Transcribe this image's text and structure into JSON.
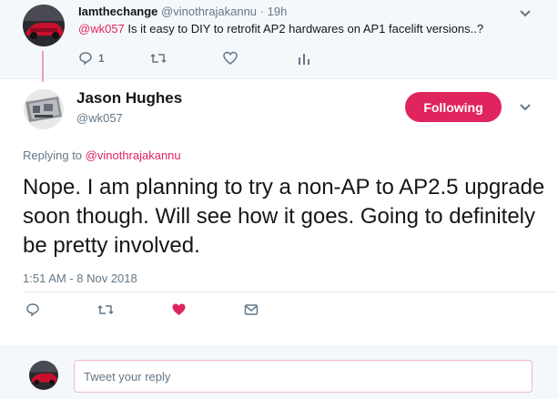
{
  "parent_tweet": {
    "display_name": "Iamthechange",
    "handle": "@vinothrajakannu",
    "separator": "·",
    "time": "19h",
    "mention": "@wk057",
    "text": " Is it easy to DIY to retrofit AP2 hardwares on AP1  facelift versions..?",
    "reply_count": "1"
  },
  "main_tweet": {
    "display_name": "Jason Hughes",
    "handle": "@wk057",
    "follow_label": "Following",
    "replying_prefix": "Replying to ",
    "replying_to": "@vinothrajakannu",
    "text": "Nope.  I am planning to try a non-AP to AP2.5 upgrade soon though. Will see how it goes.  Going to definitely be pretty involved.",
    "timestamp": "1:51 AM - 8 Nov 2018"
  },
  "reply_box": {
    "placeholder": "Tweet your reply"
  },
  "colors": {
    "accent": "#e0245e",
    "muted": "#657786",
    "background_alt": "#f5f8fa"
  },
  "icons": [
    "reply-icon",
    "retweet-icon",
    "like-icon",
    "analytics-icon",
    "message-icon",
    "chevron-down-icon"
  ]
}
